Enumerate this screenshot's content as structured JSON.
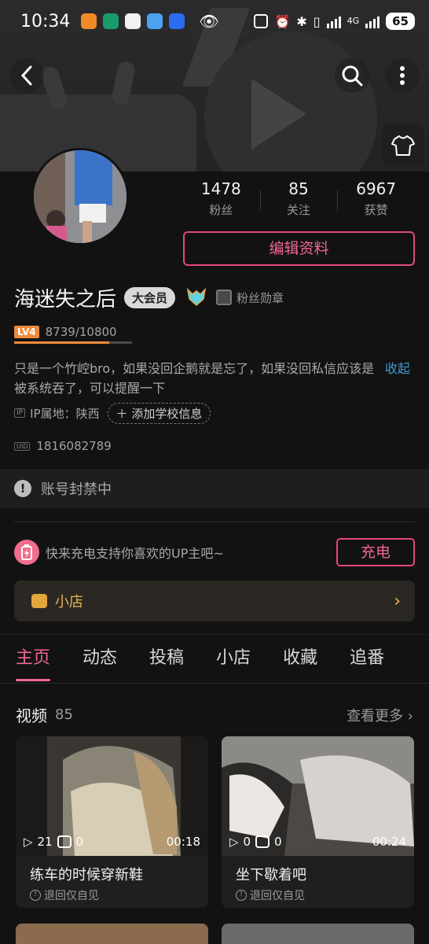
{
  "status_bar": {
    "time": "10:34",
    "battery": "65",
    "network": "4G"
  },
  "profile": {
    "stats": [
      {
        "value": "1478",
        "label": "粉丝"
      },
      {
        "value": "85",
        "label": "关注"
      },
      {
        "value": "6967",
        "label": "获赞"
      }
    ],
    "edit_label": "编辑资料",
    "name": "海迷失之后",
    "vip_badge": "大会员",
    "fans_medal": "粉丝勋章",
    "level_badge": "LV4",
    "exp": "8739/10800",
    "exp_fraction": 0.809,
    "bio": "只是一个竹崆bro，如果没回企鹅就是忘了，如果没回私信应该是被系统吞了，可以提醒一下",
    "collapse_label": "收起",
    "ip_tag": "IP",
    "ip_text": "IP属地：陕西",
    "add_school": "添加学校信息",
    "uid_tag": "UID",
    "uid": "1816082789"
  },
  "ban_notice": "账号封禁中",
  "charge": {
    "text": "快来充电支持你喜欢的UP主吧~",
    "button": "充电"
  },
  "shop": {
    "label": "小店"
  },
  "tabs": [
    "主页",
    "动态",
    "投稿",
    "小店",
    "收藏",
    "追番"
  ],
  "videos_section": {
    "title": "视频",
    "count": "85",
    "more": "查看更多"
  },
  "videos": [
    {
      "plays": "21",
      "comments": "0",
      "duration": "00:18",
      "title": "练车的时候穿新鞋",
      "status": "退回仅自见"
    },
    {
      "plays": "0",
      "comments": "0",
      "duration": "00:24",
      "title": "坐下歇着吧",
      "status": "退回仅自见"
    }
  ],
  "colors": {
    "accent": "#f06795",
    "level": "#ee8a3c",
    "link": "#3d9bd6",
    "shop": "#e8b451"
  }
}
